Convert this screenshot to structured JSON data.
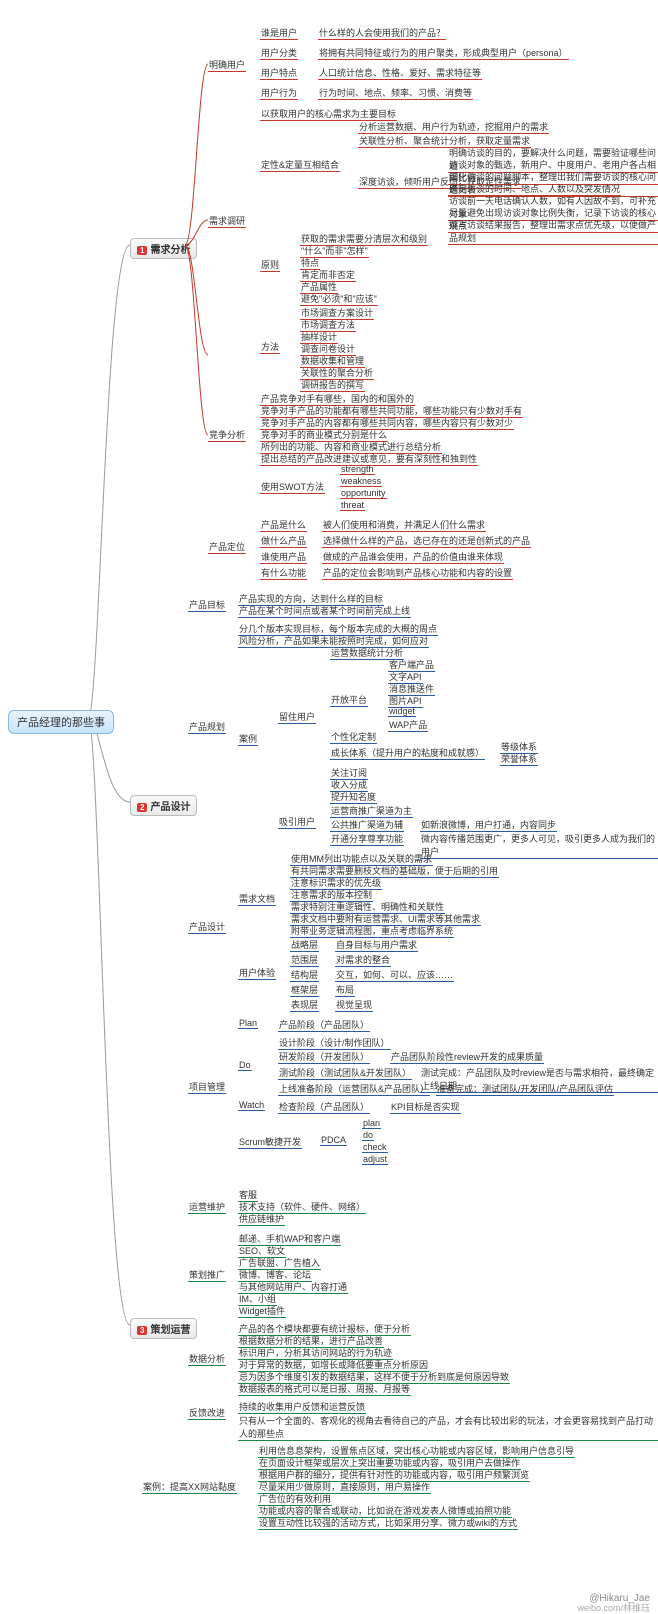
{
  "root": "产品经理的那些事",
  "watermark": {
    "handle": "@Hikaru_Jae",
    "site": "weibo.com/林维珏"
  },
  "s1": {
    "title": "需求分析",
    "num": "1",
    "mk": {
      "title": "明确用户",
      "a": {
        "q": "谁是用户",
        "a": "什么样的人会使用我们的产品？"
      },
      "b": {
        "q": "用户分类",
        "a": "将拥有共同特征或行为的用户聚类，形成典型用户（persona）"
      },
      "c": {
        "q": "用户特点",
        "a": "人口统计信息、性格、爱好、需求特征等"
      },
      "d": {
        "q": "用户行为",
        "a": "行为时间、地点、频率、习惯、消费等"
      }
    },
    "xq": {
      "title": "需求调研",
      "t1": "以获取用户的核心需求为主要目标",
      "dl": {
        "title": "定性&定量互相结合",
        "a": "分析运营数据、用户行为轨迹，挖掘用户的需求",
        "b": "关联性分析、聚合统计分析，获取定量需求",
        "c": {
          "title": "深度访谈，倾听用户反馈，获取定性需求",
          "items": [
            "明确访谈的目的，要解决什么问题，需要验证哪些问题",
            "访谈对象的甄选，新用户、中度用户、老用户各占相同比例",
            "细化访谈的问题脚本，整理出我们需要访谈的核心问题列表",
            "确定访谈的时间、地点、人数以及突发情况",
            "访谈前一天电话确认人数，如有人因故不到，可补充对象",
            "尽量避免出现访谈对象比例失衡，记录下访谈的核心观点",
            "撰写访谈结果报告，整理出需求点优先级，以便做产品规划"
          ]
        }
      },
      "yz": {
        "title": "原则",
        "t0": "获取的需求需要分清层次和级别",
        "items": [
          "\"什么\"而非\"怎样\"",
          "特点",
          "肯定而非否定",
          "产品属性",
          "避免\"必须\"和\"应该\""
        ]
      },
      "ff": {
        "title": "方法",
        "items": [
          "市场调查方案设计",
          "市场调查方法",
          "抽样设计",
          "调查问卷设计",
          "数据收集和管理",
          "关联性的聚合分析",
          "调研报告的撰写"
        ]
      }
    },
    "jz": {
      "title": "竞争分析",
      "items": [
        "产品竞争对手有哪些，国内的和国外的",
        "竞争对手产品的功能都有哪些共同功能，哪些功能只有少数对手有",
        "竞争对手产品的内容都有哪些共同内容，哪些内容只有少数对少",
        "竞争对手的商业模式分别是什么",
        "所列出的功能、内容和商业模式进行总结分析",
        "提出总结的产品改进建议或意见，要有深刻性和独到性"
      ],
      "swot": {
        "title": "使用SWOT方法",
        "items": [
          "strength",
          "weakness",
          "opportunity",
          "threat"
        ]
      }
    },
    "dw": {
      "title": "产品定位",
      "a": {
        "q": "产品是什么",
        "a": "被人们使用和消费，并满足人们什么需求"
      },
      "b": {
        "q": "做什么产品",
        "a": "选择做什么样的产品，选已存在的还是创新式的产品"
      },
      "c": {
        "q": "谁使用产品",
        "a": "做成的产品谁会使用，产品的价值由谁来体现"
      },
      "d": {
        "q": "有什么功能",
        "a": "产品的定位会影响到产品核心功能和内容的设置"
      }
    }
  },
  "s2": {
    "title": "产品设计",
    "num": "2",
    "mb": {
      "title": "产品目标",
      "a": "产品实现的方向，达到什么样的目标",
      "b": "产品在某个时间点或者某个时间前完成上线"
    },
    "gh": {
      "title": "产品规划",
      "t1": "分几个版本实现目标，每个版本完成的大概的周点",
      "t2": "风险分析，产品如果未能按照时完成，如何应对",
      "al": {
        "title": "案例",
        "ly": {
          "title": "留住用户",
          "t0": "运营数据统计分析",
          "kf": {
            "title": "开放平台",
            "items": [
              "客户端产品",
              "文字API",
              "消息推送件",
              "图片API",
              "widget",
              "WAP产品"
            ]
          },
          "gx": "个性化定制",
          "cz": {
            "title": "成长体系（提升用户的粘度和成就感）",
            "a": "等级体系",
            "b": "荣誉体系"
          },
          "items": [
            "关注订阅",
            "收入分成",
            "提升知名度"
          ]
        },
        "xy": {
          "title": "吸引用户",
          "a": "运营商推广渠道为主",
          "b": {
            "t": "公共推广渠道为辅",
            "r": "如新浪微博，用户打通，内容同步"
          },
          "c": {
            "t": "开通分享尊享功能",
            "r": "微内容传播范围更广，更多人可见，吸引更多人成为我们的用户"
          }
        }
      }
    },
    "sj": {
      "title": "产品设计",
      "xw": {
        "title": "需求文档",
        "items": [
          "使用MM列出功能点以及关联的需求",
          "有共同需求需要删枝文档的基础版，便于后期的引用",
          "注意标识需求的优先级",
          "注意需求的版本控制",
          "需求特别注重逻辑性、明确性和关联性",
          "需求文档中要附有运营需求、UI需求等其他需求",
          "附带业务逻辑流程图，重点考虑临界系统"
        ]
      },
      "ux": {
        "title": "用户体验",
        "a": {
          "t": "战略层",
          "r": "自身目标与用户需求"
        },
        "b": {
          "t": "范围层",
          "r": "对需求的整合"
        },
        "c": {
          "t": "结构层",
          "r": "交互，如何、可以、应该……"
        },
        "d": {
          "t": "框架层",
          "r": "布局"
        },
        "e": {
          "t": "表现层",
          "r": "视觉呈现"
        }
      }
    },
    "xm": {
      "title": "项目管理",
      "plan": {
        "t": "Plan",
        "r": "产品阶段（产品团队）"
      },
      "do": {
        "t": "Do",
        "a": "设计阶段（设计/制作团队）",
        "b": {
          "t": "研发阶段（开发团队）",
          "r": "产品团队阶段性review开发的成果质量"
        },
        "c": {
          "t": "测试阶段（测试团队&开发团队）",
          "r": "测试完成：产品团队及时review是否与需求相符，最终确定上线日期"
        },
        "d": {
          "t": "上线准备阶段（运营团队&产品团队）",
          "r": "准备完成：测试团队/开发团队/产品团队评估"
        }
      },
      "watch": {
        "t": "Watch",
        "a": "检查阶段（产品团队）",
        "r": "KPI目标是否实现"
      },
      "scrum": {
        "t": "Scrum敏捷开发",
        "p": "PDCA",
        "items": [
          "plan",
          "do",
          "check",
          "adjust"
        ]
      }
    }
  },
  "s3": {
    "title": "策划运营",
    "num": "3",
    "wy": {
      "title": "运营维护",
      "items": [
        "客服",
        "技术支持（软件、硬件、网络）",
        "供应链维护"
      ]
    },
    "tg": {
      "title": "策划推广",
      "items": [
        "邮递、手机WAP和客户端",
        "SEO、软文",
        "广告联盟、广告植入",
        "微博、博客、论坛",
        "与其他网站用户、内容打通",
        "IM、小组",
        "Widget插件"
      ]
    },
    "sj": {
      "title": "数据分析",
      "items": [
        "产品的各个模块都要有统计报标，便于分析",
        "根据数据分析的结果，进行产品改善",
        "标识用户，分析其访问网站的行为轨迹",
        "对于异常的数据，如增长或降低要重点分析原因",
        "忌为因多个维度引发的数据结果，这样不便于分析到底是何原因导致",
        "数据报表的格式可以是日报、周报、月报等"
      ]
    },
    "fk": {
      "title": "反馈改进",
      "a": "持续的收集用户反馈和运营反馈",
      "b": "只有从一个全面的、客观化的视角去看待自己的产品，才会有比较出彩的玩法，才会更容易找到产品打动人的那些点"
    },
    "al": {
      "title": "案例：提高XX网站黏度",
      "items": [
        "利用信息息架构，设置焦点区域，突出核心功能或内容区域，影响用户信息引导",
        "在页面设计框架或层次上突出重要功能或内容，吸引用户去做操作",
        "根据用户群的细分，提供有针对性的功能或内容，吸引用户频繁浏览",
        "尽量采用少做原则，直接原则，用户易操作",
        "广告位的有效利用",
        "功能或内容的聚合或联动，比如说在游戏发表人微博或拍照功能",
        "设置互动性比较强的活动方式，比如采用分享、微力或wiki的方式"
      ]
    }
  }
}
